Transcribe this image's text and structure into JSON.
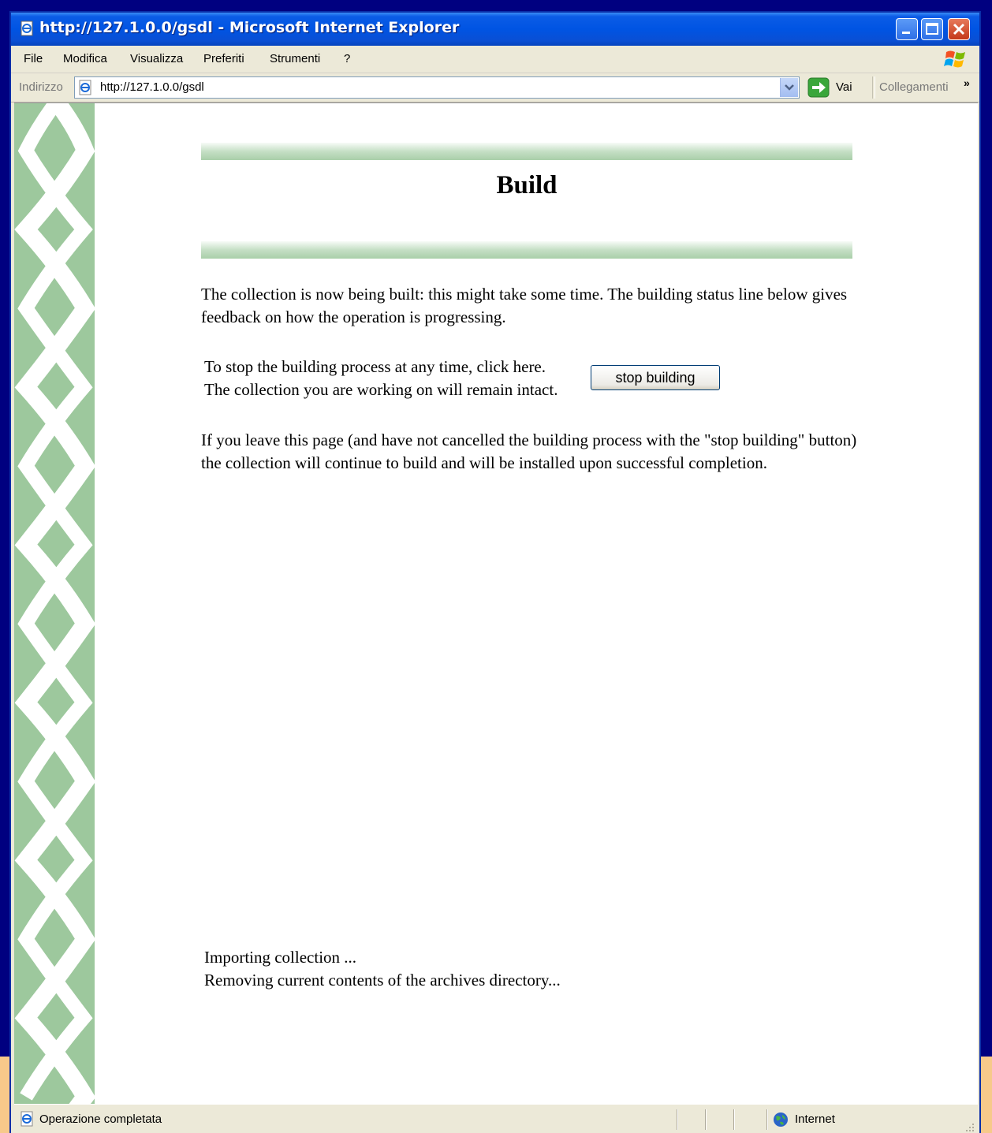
{
  "window": {
    "title": "http://127.1.0.0/gsdl - Microsoft Internet Explorer"
  },
  "menu": [
    "File",
    "Modifica",
    "Visualizza",
    "Preferiti",
    "Strumenti",
    "?"
  ],
  "address": {
    "label": "Indirizzo",
    "url": "http://127.1.0.0/gsdl",
    "go_label": "Vai",
    "links_label": "Collegamenti",
    "links_more": "»"
  },
  "page": {
    "title": "Build",
    "intro": "The collection is now being built: this might take some time. The building status line below gives feedback on how the operation is progressing.",
    "stop_line1": "To stop the building process at any time, click here.",
    "stop_line2": "The collection you are working on will remain intact.",
    "stop_button": "stop building",
    "leave_text": "If you leave this page (and have not cancelled the building process with the \"stop building\" button) the collection will continue to build and will be installed upon successful completion.",
    "status_line1": "Importing collection ...",
    "status_line2": "Removing current contents of the archives directory..."
  },
  "statusbar": {
    "text": "Operazione completata",
    "zone": "Internet"
  },
  "colors": {
    "band": "#9dc89d",
    "titlebar": "#0054e3",
    "background": "#000080"
  }
}
